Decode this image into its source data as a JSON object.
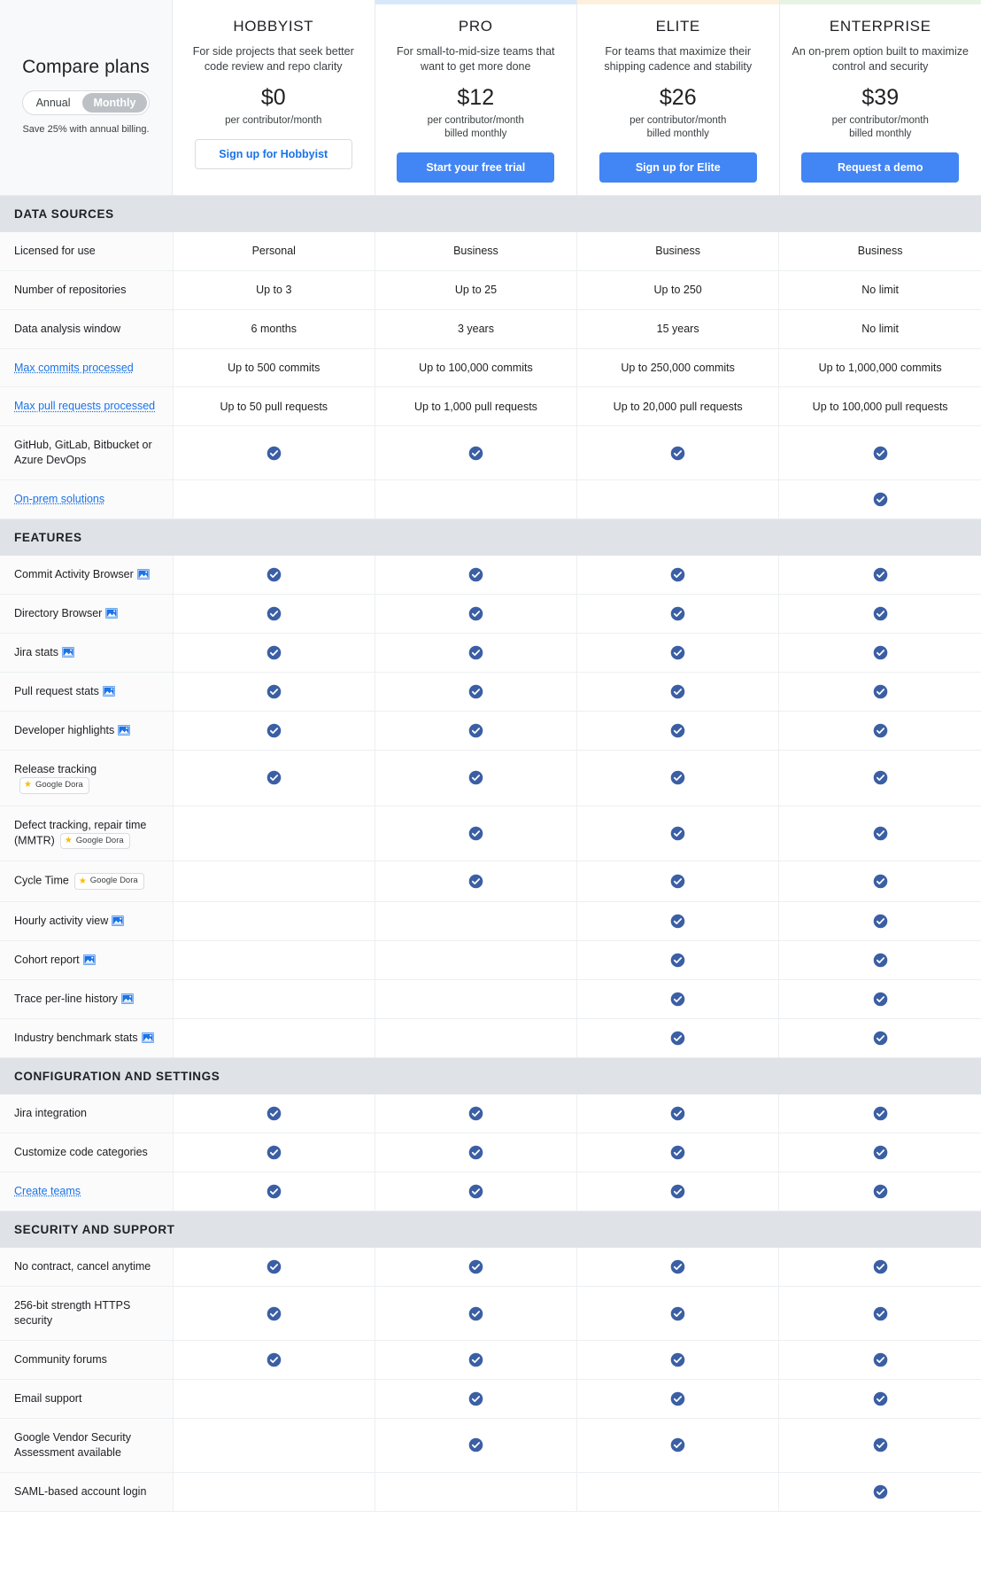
{
  "compare": {
    "title": "Compare plans",
    "billing_options": [
      "Annual",
      "Monthly"
    ],
    "billing_selected": "Monthly",
    "save_note": "Save 25% with annual billing."
  },
  "colors": {
    "accent_pro": "#d7e8fb",
    "accent_elite": "#fdf1dd",
    "accent_enterprise": "#e6f5e3",
    "primary_button": "#4285f4",
    "link": "#1a73e8",
    "check": "#3b5fa4",
    "star": "#fbbc04",
    "section_header_bg": "#dfe3e8"
  },
  "plans": [
    {
      "name": "HOBBYIST",
      "description": "For side projects that seek better code review and repo clarity",
      "price": "$0",
      "per": "per contributor/month",
      "billed": "",
      "cta": "Sign up for Hobbyist",
      "cta_style": "ghost",
      "accent": "none"
    },
    {
      "name": "PRO",
      "description": "For small-to-mid-size teams that want to get more done",
      "price": "$12",
      "per": "per contributor/month",
      "billed": "billed monthly",
      "cta": "Start your free trial",
      "cta_style": "primary",
      "accent": "#d7e8fb"
    },
    {
      "name": "ELITE",
      "description": "For teams that maximize their shipping cadence and stability",
      "price": "$26",
      "per": "per contributor/month",
      "billed": "billed monthly",
      "cta": "Sign up for Elite",
      "cta_style": "primary",
      "accent": "#fdf1dd"
    },
    {
      "name": "ENTERPRISE",
      "description": "An on-prem option built to maximize control and security",
      "price": "$39",
      "per": "per contributor/month",
      "billed": "billed monthly",
      "cta": "Request a demo",
      "cta_style": "primary",
      "accent": "#e6f5e3"
    }
  ],
  "dora_badge_label": "Google Dora",
  "sections": [
    {
      "title": "DATA SOURCES",
      "rows": [
        {
          "label": "Licensed for use",
          "link": false,
          "icon": "none",
          "values": [
            "Personal",
            "Business",
            "Business",
            "Business"
          ]
        },
        {
          "label": "Number of repositories",
          "link": false,
          "icon": "none",
          "values": [
            "Up to 3",
            "Up to 25",
            "Up to 250",
            "No limit"
          ]
        },
        {
          "label": "Data analysis window",
          "link": false,
          "icon": "none",
          "values": [
            "6 months",
            "3 years",
            "15 years",
            "No limit"
          ]
        },
        {
          "label": "Max commits processed",
          "link": true,
          "icon": "none",
          "values": [
            "Up to 500 commits",
            "Up to 100,000 commits",
            "Up to 250,000 commits",
            "Up to 1,000,000 commits"
          ]
        },
        {
          "label": "Max pull requests processed",
          "link": true,
          "icon": "none",
          "values": [
            "Up to 50 pull requests",
            "Up to 1,000 pull requests",
            "Up to 20,000 pull requests",
            "Up to 100,000 pull requests"
          ]
        },
        {
          "label": "GitHub, GitLab, Bitbucket or Azure DevOps",
          "link": false,
          "icon": "none",
          "values": [
            "check",
            "check",
            "check",
            "check"
          ]
        },
        {
          "label": "On-prem solutions",
          "link": true,
          "icon": "none",
          "values": [
            "",
            "",
            "",
            "check"
          ]
        }
      ]
    },
    {
      "title": "FEATURES",
      "rows": [
        {
          "label": "Commit Activity Browser",
          "link": false,
          "icon": "image",
          "values": [
            "check",
            "check",
            "check",
            "check"
          ]
        },
        {
          "label": "Directory Browser",
          "link": false,
          "icon": "image",
          "values": [
            "check",
            "check",
            "check",
            "check"
          ]
        },
        {
          "label": "Jira stats",
          "link": false,
          "icon": "image",
          "values": [
            "check",
            "check",
            "check",
            "check"
          ]
        },
        {
          "label": "Pull request stats",
          "link": false,
          "icon": "image",
          "values": [
            "check",
            "check",
            "check",
            "check"
          ]
        },
        {
          "label": "Developer highlights",
          "link": false,
          "icon": "image",
          "values": [
            "check",
            "check",
            "check",
            "check"
          ]
        },
        {
          "label": "Release tracking",
          "link": false,
          "icon": "dora",
          "values": [
            "check",
            "check",
            "check",
            "check"
          ]
        },
        {
          "label": "Defect tracking, repair time (MMTR)",
          "link": false,
          "icon": "dora",
          "values": [
            "",
            "check",
            "check",
            "check"
          ]
        },
        {
          "label": "Cycle Time",
          "link": false,
          "icon": "dora",
          "values": [
            "",
            "check",
            "check",
            "check"
          ]
        },
        {
          "label": "Hourly activity view",
          "link": false,
          "icon": "image",
          "values": [
            "",
            "",
            "check",
            "check"
          ]
        },
        {
          "label": "Cohort report",
          "link": false,
          "icon": "image",
          "values": [
            "",
            "",
            "check",
            "check"
          ]
        },
        {
          "label": "Trace per-line history",
          "link": false,
          "icon": "image",
          "values": [
            "",
            "",
            "check",
            "check"
          ]
        },
        {
          "label": "Industry benchmark stats",
          "link": false,
          "icon": "image",
          "values": [
            "",
            "",
            "check",
            "check"
          ]
        }
      ]
    },
    {
      "title": "CONFIGURATION AND SETTINGS",
      "rows": [
        {
          "label": "Jira integration",
          "link": false,
          "icon": "none",
          "values": [
            "check",
            "check",
            "check",
            "check"
          ]
        },
        {
          "label": "Customize code categories",
          "link": false,
          "icon": "none",
          "values": [
            "check",
            "check",
            "check",
            "check"
          ]
        },
        {
          "label": "Create teams",
          "link": true,
          "icon": "none",
          "values": [
            "check",
            "check",
            "check",
            "check"
          ]
        }
      ]
    },
    {
      "title": "SECURITY AND SUPPORT",
      "rows": [
        {
          "label": "No contract, cancel anytime",
          "link": false,
          "icon": "none",
          "values": [
            "check",
            "check",
            "check",
            "check"
          ]
        },
        {
          "label": "256-bit strength HTTPS security",
          "link": false,
          "icon": "none",
          "values": [
            "check",
            "check",
            "check",
            "check"
          ]
        },
        {
          "label": "Community forums",
          "link": false,
          "icon": "none",
          "values": [
            "check",
            "check",
            "check",
            "check"
          ]
        },
        {
          "label": "Email support",
          "link": false,
          "icon": "none",
          "values": [
            "",
            "check",
            "check",
            "check"
          ]
        },
        {
          "label": "Google Vendor Security Assessment available",
          "link": false,
          "icon": "none",
          "values": [
            "",
            "check",
            "check",
            "check"
          ]
        },
        {
          "label": "SAML-based account login",
          "link": false,
          "icon": "none",
          "values": [
            "",
            "",
            "",
            "check"
          ]
        }
      ]
    }
  ]
}
